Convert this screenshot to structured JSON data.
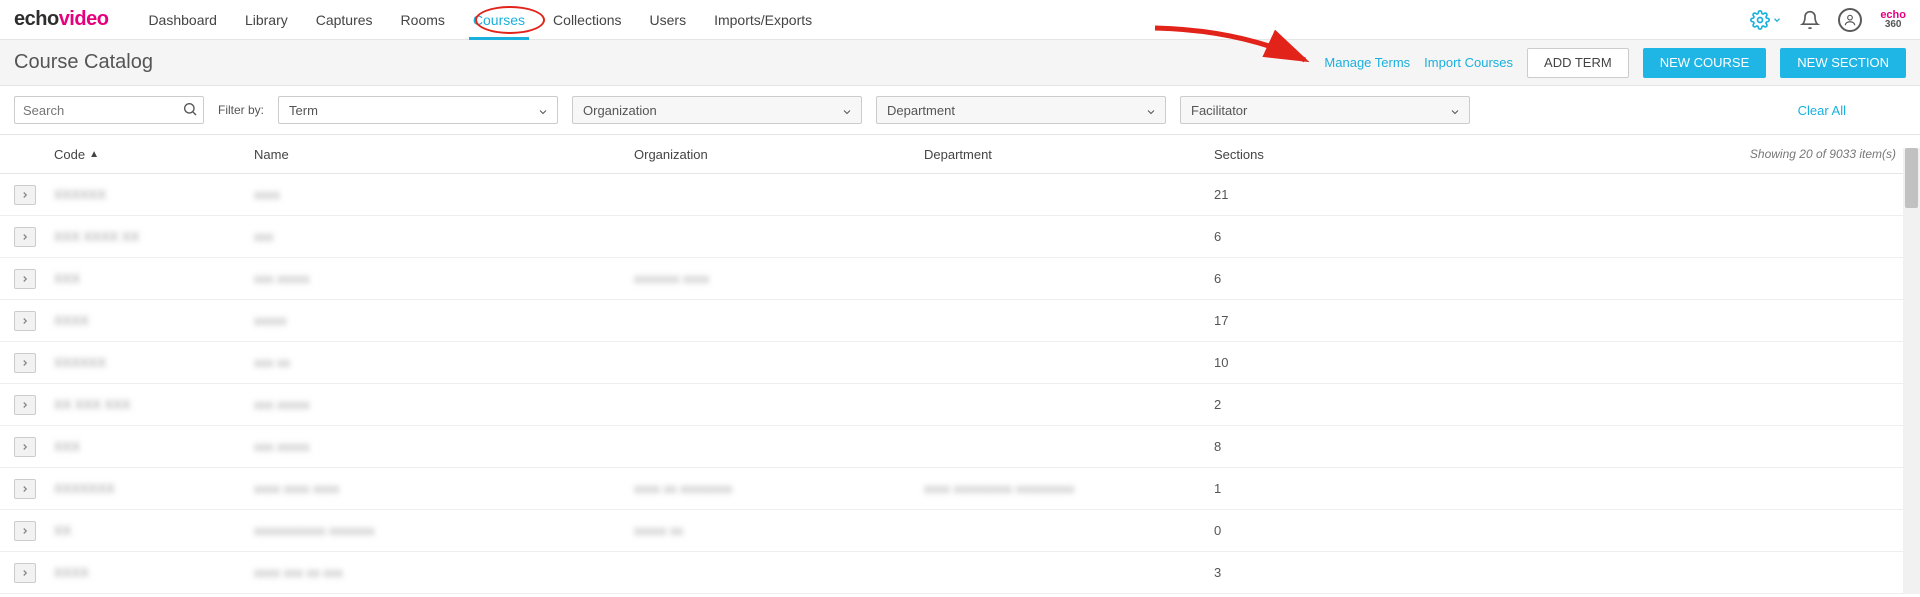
{
  "brand": {
    "echo": "echo",
    "video": "video"
  },
  "nav": {
    "items": [
      "Dashboard",
      "Library",
      "Captures",
      "Rooms",
      "Courses",
      "Collections",
      "Users",
      "Imports/Exports"
    ],
    "active_index": 4
  },
  "small_brand": {
    "line1": "echo",
    "line2": "360"
  },
  "page_title": "Course Catalog",
  "actions": {
    "manage_terms": "Manage Terms",
    "import_courses": "Import Courses",
    "add_term": "ADD TERM",
    "new_course": "NEW COURSE",
    "new_section": "NEW SECTION"
  },
  "search": {
    "placeholder": "Search"
  },
  "filter_by_label": "Filter by:",
  "filters": {
    "term": "Term",
    "organization": "Organization",
    "department": "Department",
    "facilitator": "Facilitator"
  },
  "clear_all": "Clear All",
  "columns": {
    "code": "Code",
    "name": "Name",
    "organization": "Organization",
    "department": "Department",
    "sections": "Sections"
  },
  "count_text": "Showing 20 of 9033 item(s)",
  "rows": [
    {
      "code": "XXXXXX",
      "name": "xxxx",
      "org": "",
      "dept": "",
      "sections": "21"
    },
    {
      "code": "XXX XXXX XX",
      "name": "xxx",
      "org": "",
      "dept": "",
      "sections": "6"
    },
    {
      "code": "XXX",
      "name": "xxx xxxxx",
      "org": "xxxxxxx xxxx",
      "dept": "",
      "sections": "6"
    },
    {
      "code": "XXXX",
      "name": "xxxxx",
      "org": "",
      "dept": "",
      "sections": "17"
    },
    {
      "code": "XXXXXX",
      "name": "xxx xx",
      "org": "",
      "dept": "",
      "sections": "10"
    },
    {
      "code": "XX XXX XXX",
      "name": "xxx xxxxx",
      "org": "",
      "dept": "",
      "sections": "2"
    },
    {
      "code": "XXX",
      "name": "xxx xxxxx",
      "org": "",
      "dept": "",
      "sections": "8"
    },
    {
      "code": "XXXXXXX",
      "name": "xxxx xxxx xxxx",
      "org": "xxxx xx xxxxxxxx",
      "dept": "xxxx xxxxxxxxx xxxxxxxxx",
      "sections": "1"
    },
    {
      "code": "XX",
      "name": "xxxxxxxxxxx xxxxxxx",
      "org": "xxxxx xx",
      "dept": "",
      "sections": "0"
    },
    {
      "code": "XXXX",
      "name": "xxxx xxx xx xxx",
      "org": "",
      "dept": "",
      "sections": "3"
    }
  ]
}
